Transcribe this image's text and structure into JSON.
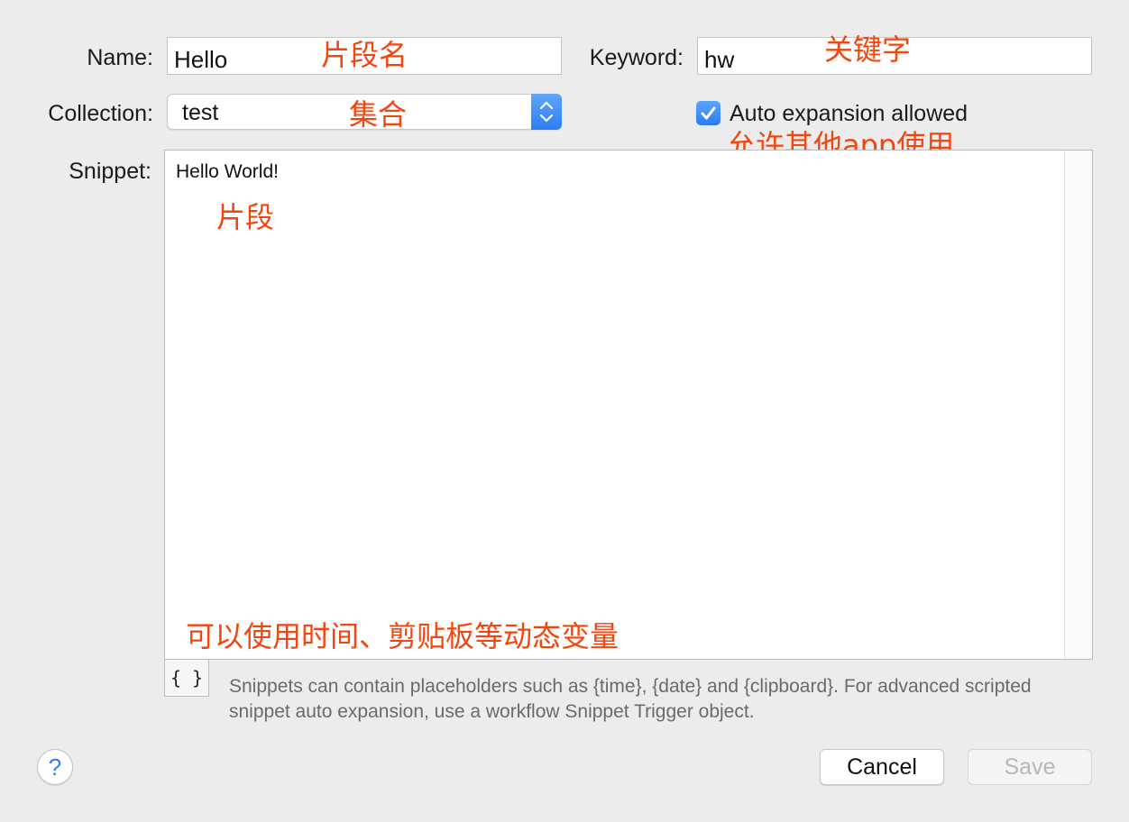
{
  "form": {
    "name_label": "Name:",
    "name_value": "Hello",
    "keyword_label": "Keyword:",
    "keyword_value": "hw",
    "collection_label": "Collection:",
    "collection_value": "test",
    "auto_expansion_label": "Auto expansion allowed",
    "auto_expansion_checked": true,
    "snippet_label": "Snippet:",
    "snippet_value": "Hello World!",
    "placeholder_button_label": "{ }",
    "hint_text": "Snippets can contain placeholders such as {time}, {date} and {clipboard}. For advanced scripted snippet auto expansion, use a workflow Snippet Trigger object."
  },
  "annotations": {
    "name": "片段名",
    "keyword": "关键字",
    "collection": "集合",
    "auto_expansion": "允许其他app使用",
    "snippet": "片段",
    "placeholders": "可以使用时间、剪贴板等动态变量"
  },
  "footer": {
    "help_label": "?",
    "cancel_label": "Cancel",
    "save_label": "Save"
  },
  "colors": {
    "accent": "#2f7ff0",
    "annotation": "#f2460e",
    "window_background": "#ececec"
  },
  "icons": {
    "help": "question-icon",
    "checkbox": "checkmark-icon",
    "select": "up-down-chevron-icon"
  }
}
